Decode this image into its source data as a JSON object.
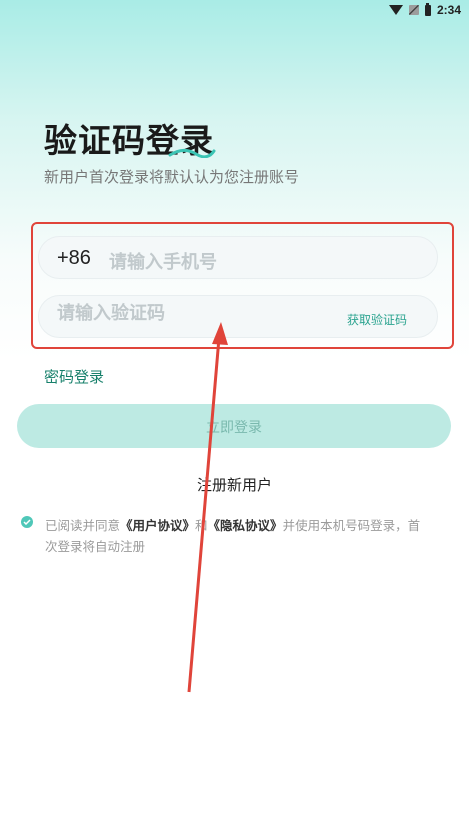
{
  "status_bar": {
    "time": "2:34"
  },
  "login": {
    "title": "验证码登录",
    "subtitle": "新用户首次登录将默认认为您注册账号",
    "country_code": "+86",
    "phone_placeholder": "请输入手机号",
    "code_placeholder": "请输入验证码",
    "get_code": "获取验证码",
    "password_login": "密码登录",
    "login_button": "立即登录",
    "register": "注册新用户",
    "agreement": {
      "prefix": "已阅读并同意",
      "user_agreement": "《用户协议》",
      "and": "和",
      "privacy_agreement": "《隐私协议》",
      "suffix": "并使用本机号码登录，首次登录将自动注册"
    }
  },
  "colors": {
    "accent": "#2aa38f",
    "button_bg": "#bdeae3",
    "highlight": "#e0443a"
  },
  "icons": [
    "wifi-icon",
    "sim-icon",
    "battery-icon",
    "check-icon"
  ]
}
